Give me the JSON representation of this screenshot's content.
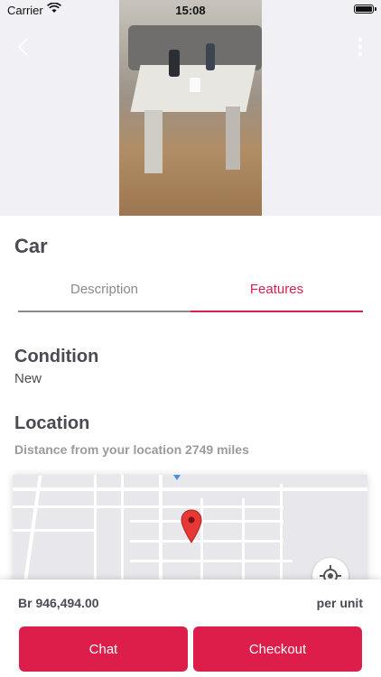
{
  "status_bar": {
    "carrier": "Carrier",
    "time": "15:08"
  },
  "product": {
    "title": "Car"
  },
  "tabs": [
    {
      "label": "Description",
      "active": false
    },
    {
      "label": "Features",
      "active": true
    }
  ],
  "features": {
    "condition_heading": "Condition",
    "condition_value": "New",
    "location_heading": "Location",
    "distance_text": "Distance from your location 2749 miles"
  },
  "footer": {
    "price": "Br 946,494.00",
    "unit": "per unit",
    "chat_label": "Chat",
    "checkout_label": "Checkout"
  },
  "colors": {
    "accent": "#dd1e4b",
    "text": "#4a4a52",
    "muted": "#8a8a8f"
  },
  "icons": [
    "wifi-icon",
    "battery-icon",
    "back-arrow-icon",
    "more-vertical-icon",
    "map-pin-icon",
    "locate-icon"
  ]
}
